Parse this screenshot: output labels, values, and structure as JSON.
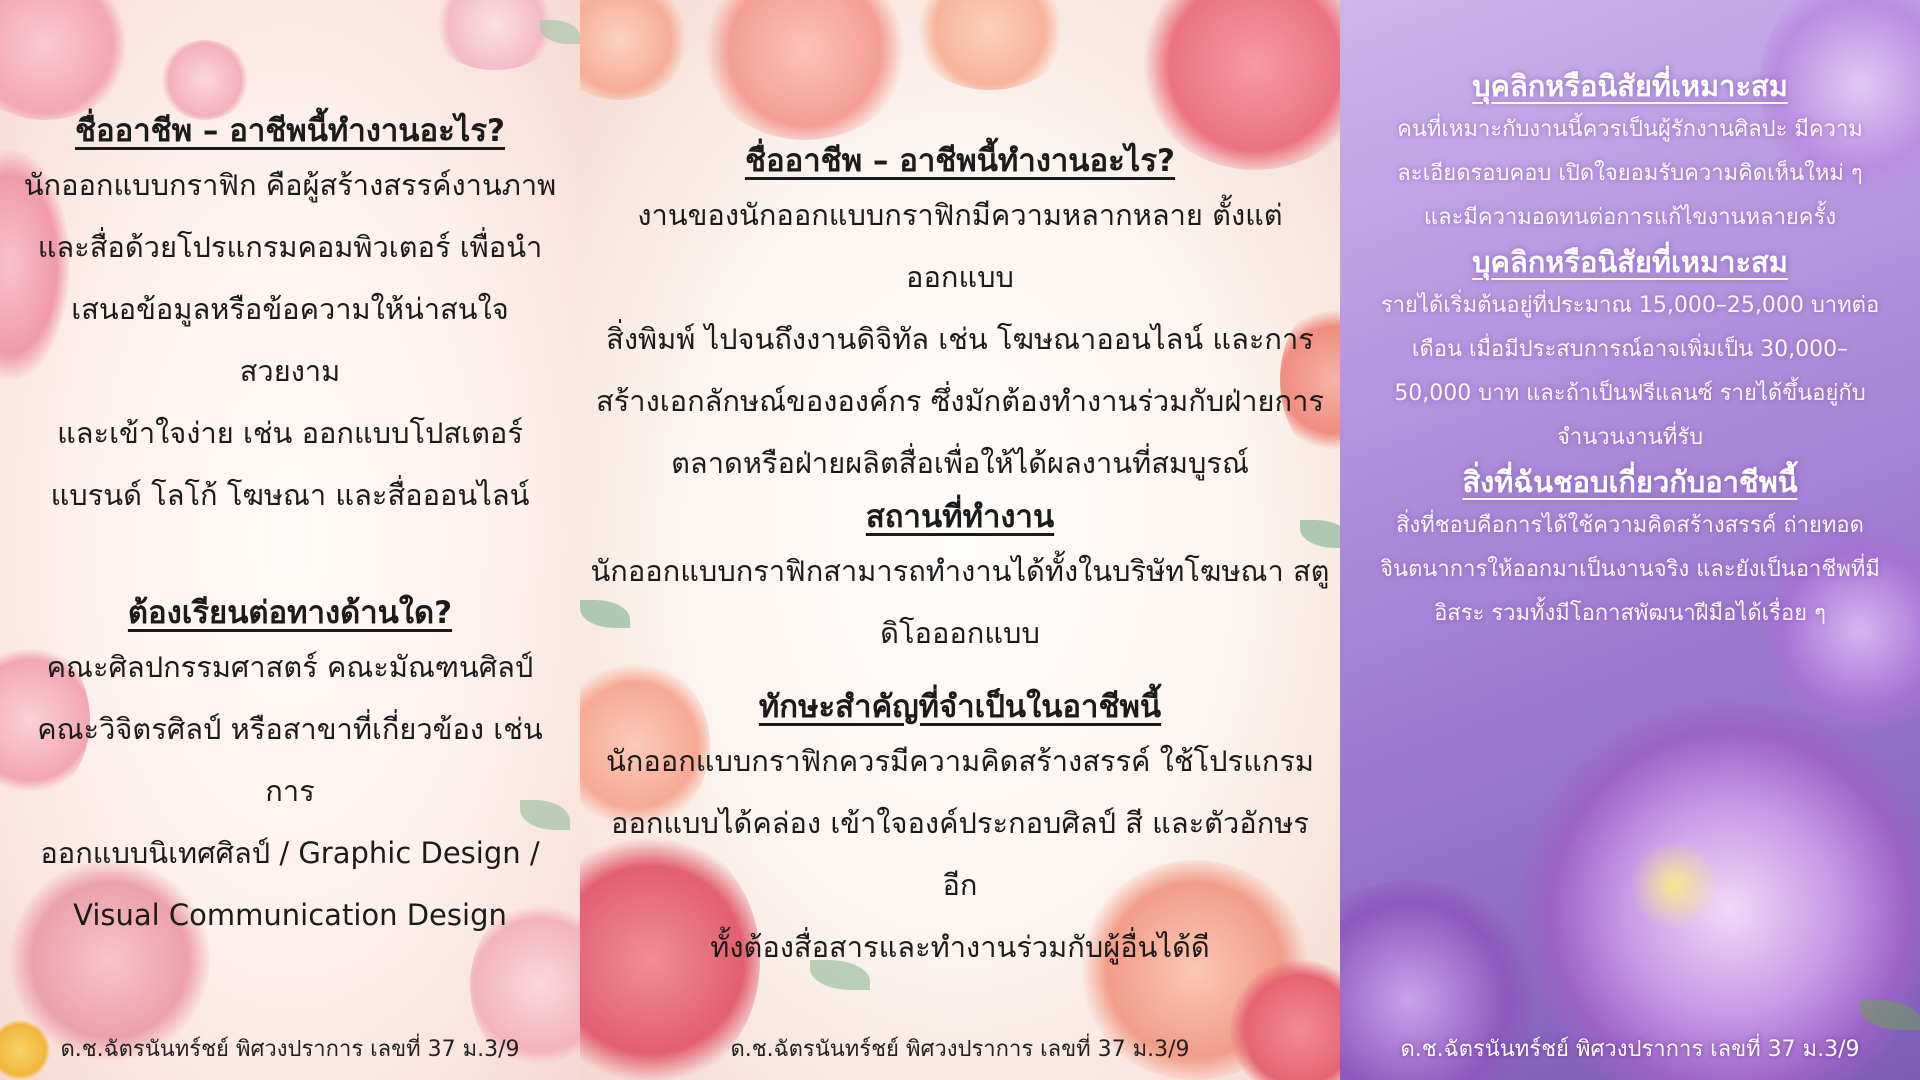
{
  "panel1": {
    "heading1": "ชื่ออาชีพ – อาชีพนี้ทำงานอะไร?",
    "text1_lines": [
      "นักออกแบบกราฟิก คือผู้สร้างสรรค์งานภาพ",
      "และสื่อด้วยโปรแกรมคอมพิวเตอร์ เพื่อนำ",
      "เสนอข้อมูลหรือข้อความให้น่าสนใจ สวยงาม",
      "และเข้าใจง่าย เช่น ออกแบบโปสเตอร์",
      "แบรนด์ โลโก้ โฆษณา และสื่อออนไลน์"
    ],
    "heading2": "ต้องเรียนต่อทางด้านใด?",
    "text2_lines": [
      "คณะศิลปกรรมศาสตร์ คณะมัณฑนศิลป์",
      "คณะวิจิตรศิลป์ หรือสาขาที่เกี่ยวข้อง เช่น การ",
      "ออกแบบนิเทศศิลป์ / Graphic Design /",
      "Visual Communication Design"
    ],
    "footer": "ด.ช.ฉัตรนันทร์ชย์ พิศวงปราการ เลขที่ 37 ม.3/9"
  },
  "panel2": {
    "heading1": "ชื่ออาชีพ – อาชีพนี้ทำงานอะไร?",
    "text1_lines": [
      "งานของนักออกแบบกราฟิกมีความหลากหลาย ตั้งแต่ออกแบบ",
      "สิ่งพิมพ์  ไปจนถึงงานดิจิทัล เช่น โฆษณาออนไลน์ และการ",
      "สร้างเอกลักษณ์ขององค์กร ซึ่งมักต้องทำงานร่วมกับฝ่ายการ",
      "ตลาดหรือฝ่ายผลิตสื่อเพื่อให้ได้ผลงานที่สมบูรณ์"
    ],
    "heading2": "สถานที่ทำงาน",
    "text2_lines": [
      "นักออกแบบกราฟิกสามารถทำงานได้ทั้งในบริษัทโฆษณา สตู",
      "ดิโอออกแบบ"
    ],
    "heading3": "ทักษะสำคัญที่จำเป็นในอาชีพนี้",
    "text3_lines": [
      "นักออกแบบกราฟิกควรมีความคิดสร้างสรรค์ ใช้โปรแกรม",
      "ออกแบบได้คล่อง เข้าใจองค์ประกอบศิลป์ สี และตัวอักษร อีก",
      "ทั้งต้องสื่อสารและทำงานร่วมกับผู้อื่นได้ดี"
    ],
    "footer": "ด.ช.ฉัตรนันทร์ชย์ พิศวงปราการ เลขที่ 37 ม.3/9"
  },
  "panel3": {
    "heading1": "บุคลิกหรือนิสัยที่เหมาะสม",
    "text1_lines": [
      "คนที่เหมาะกับงานนี้ควรเป็นผู้รักงานศิลปะ มีความ",
      "ละเอียดรอบคอบ เปิดใจยอมรับความคิดเห็นใหม่ ๆ",
      "และมีความอดทนต่อการแก้ไขงานหลายครั้ง"
    ],
    "heading2": "บุคลิกหรือนิสัยที่เหมาะสม",
    "text2_lines": [
      "รายได้เริ่มต้นอยู่ที่ประมาณ 15,000–25,000 บาทต่อ",
      "เดือน เมื่อมีประสบการณ์อาจเพิ่มเป็น 30,000–",
      "50,000 บาท และถ้าเป็นฟรีแลนซ์ รายได้ขึ้นอยู่กับ",
      "จำนวนงานที่รับ"
    ],
    "heading3": "สิ่งที่ฉันชอบเกี่ยวกับอาชีพนี้",
    "text3_lines": [
      "สิ่งที่ชอบคือการได้ใช้ความคิดสร้างสรรค์ ถ่ายทอด",
      "จินตนาการให้ออกมาเป็นงานจริง และยังเป็นอาชีพที่มี",
      "อิสระ รวมทั้งมีโอกาสพัฒนาฝีมือได้เรื่อย ๆ"
    ],
    "footer": "ด.ช.ฉัตรนันทร์ชย์ พิศวงปราการ เลขที่ 37 ม.3/9"
  },
  "colors": {
    "panel1_bg": "#fdf0ec",
    "panel2_bg": "#fbf3ee",
    "panel3_bg": "#a985d6",
    "pink_flower": "#f4a6b3",
    "peach_flower": "#f7b199",
    "rose": "#ee7a86",
    "purple_lily": "#9b62c9"
  }
}
